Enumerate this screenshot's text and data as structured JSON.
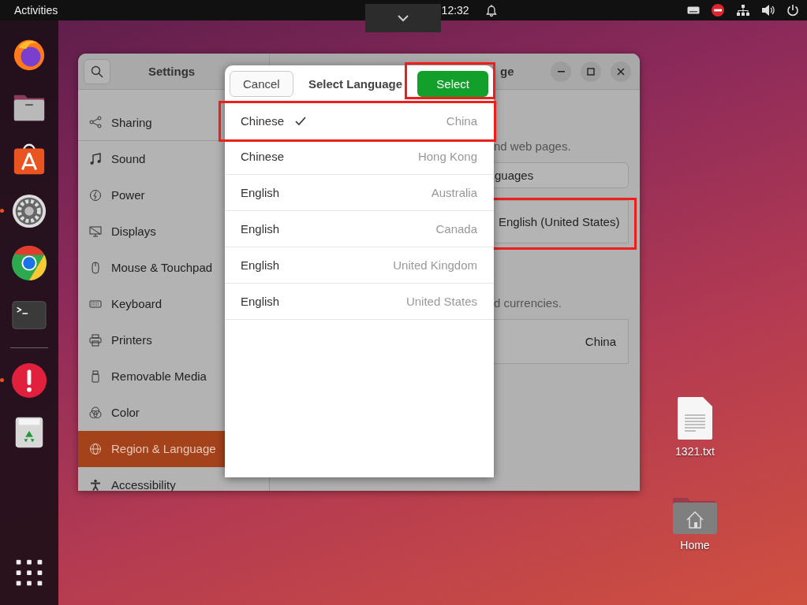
{
  "top_bar": {
    "activities": "Activities",
    "clock": "12:32"
  },
  "dock": [
    {
      "kind": "firefox",
      "running": false
    },
    {
      "kind": "files",
      "running": false
    },
    {
      "kind": "store",
      "running": false
    },
    {
      "kind": "settings",
      "running": true
    },
    {
      "kind": "chrome",
      "running": false
    },
    {
      "kind": "terminal",
      "running": false
    },
    {
      "kind": "separator"
    },
    {
      "kind": "alert",
      "running": true
    },
    {
      "kind": "trash",
      "running": false
    },
    {
      "kind": "apps",
      "running": false
    }
  ],
  "desktop_icons": [
    {
      "kind": "file",
      "label": "1321.txt"
    },
    {
      "kind": "home",
      "label": "Home"
    }
  ],
  "settings_window": {
    "title": "Settings",
    "panel_title": "ge",
    "sidebar": [
      {
        "kind": "share",
        "label": "Sharing",
        "selected": false
      },
      {
        "kind": "note",
        "label": "Sound",
        "selected": false
      },
      {
        "kind": "power",
        "label": "Power",
        "selected": false
      },
      {
        "kind": "display",
        "label": "Displays",
        "selected": false
      },
      {
        "kind": "mouse",
        "label": "Mouse & Touchpad",
        "selected": false
      },
      {
        "kind": "keyboard",
        "label": "Keyboard",
        "selected": false
      },
      {
        "kind": "printer",
        "label": "Printers",
        "selected": false
      },
      {
        "kind": "usb",
        "label": "Removable Media",
        "selected": false
      },
      {
        "kind": "color",
        "label": "Color",
        "selected": false
      },
      {
        "kind": "globe",
        "label": "Region & Language",
        "selected": true
      },
      {
        "kind": "person",
        "label": "Accessibility",
        "selected": false
      }
    ],
    "language_hint": "nd web pages.",
    "languages_button": "guages",
    "language_value": {
      "text": "English (United States)",
      "highlighted": true
    },
    "formats_hint": "d currencies.",
    "formats_value": "China"
  },
  "dialog": {
    "title": "Select Language",
    "cancel": "Cancel",
    "confirm": {
      "label": "Select",
      "highlighted": true
    },
    "options": [
      {
        "language": "Chinese",
        "region": "China",
        "selected": true,
        "highlighted": true
      },
      {
        "language": "Chinese",
        "region": "Hong Kong",
        "selected": false,
        "highlighted": false
      },
      {
        "language": "English",
        "region": "Australia",
        "selected": false,
        "highlighted": false
      },
      {
        "language": "English",
        "region": "Canada",
        "selected": false,
        "highlighted": false
      },
      {
        "language": "English",
        "region": "United Kingdom",
        "selected": false,
        "highlighted": false
      },
      {
        "language": "English",
        "region": "United States",
        "selected": false,
        "highlighted": false
      }
    ]
  }
}
